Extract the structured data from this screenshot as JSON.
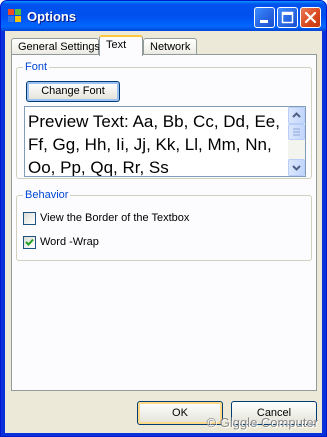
{
  "window": {
    "title": "Options"
  },
  "tabs": [
    {
      "label": "General Settings"
    },
    {
      "label": "Text"
    },
    {
      "label": "Network"
    }
  ],
  "font_group": {
    "title": "Font",
    "change_font_label": "Change Font",
    "preview_text": "Preview Text: Aa, Bb, Cc, Dd, Ee, Ff, Gg, Hh, Ii, Jj, Kk, Ll, Mm, Nn, Oo, Pp, Qq, Rr, Ss"
  },
  "behavior_group": {
    "title": "Behavior",
    "options": [
      {
        "label": "View the Border of the Textbox",
        "checked": false
      },
      {
        "label": "Word -Wrap",
        "checked": true
      }
    ]
  },
  "buttons": {
    "ok_label": "OK",
    "cancel_label": "Cancel"
  },
  "watermark": "© Giggle Computer"
}
